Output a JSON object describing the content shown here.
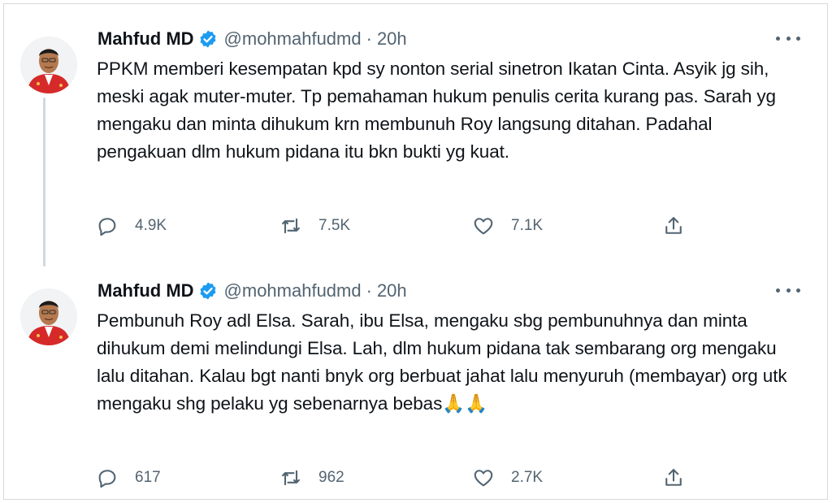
{
  "tweets": [
    {
      "author_name": "Mahfud MD",
      "handle": "@mohmahfudmd",
      "separator": "·",
      "time": "20h",
      "text": "PPKM memberi kesempatan kpd sy nonton serial sinetron Ikatan Cinta. Asyik jg sih, meski agak muter-muter. Tp pemahaman hukum penulis cerita kurang pas. Sarah yg mengaku dan minta dihukum krn membunuh Roy langsung ditahan. Padahal pengakuan dlm hukum pidana itu bkn bukti yg kuat.",
      "replies": "4.9K",
      "retweets": "7.5K",
      "likes": "7.1K"
    },
    {
      "author_name": "Mahfud MD",
      "handle": "@mohmahfudmd",
      "separator": "·",
      "time": "20h",
      "text": "Pembunuh Roy adl Elsa. Sarah, ibu Elsa, mengaku sbg pembunuhnya dan minta dihukum demi melindungi Elsa. Lah, dlm hukum pidana tak sembarang org mengaku lalu ditahan. Kalau bgt nanti bnyk org berbuat jahat lalu menyuruh (membayar) org utk mengaku shg pelaku yg sebenarnya bebas🙏🙏",
      "replies": "617",
      "retweets": "962",
      "likes": "2.7K"
    }
  ],
  "icons": {
    "verified": "verified-badge-icon",
    "more": "more-options-icon",
    "reply": "reply-icon",
    "retweet": "retweet-icon",
    "like": "like-icon",
    "share": "share-icon"
  },
  "colors": {
    "verified_blue": "#1d9bf0",
    "muted": "#536471",
    "text": "#0f1419",
    "thread_line": "#cfd9de"
  }
}
